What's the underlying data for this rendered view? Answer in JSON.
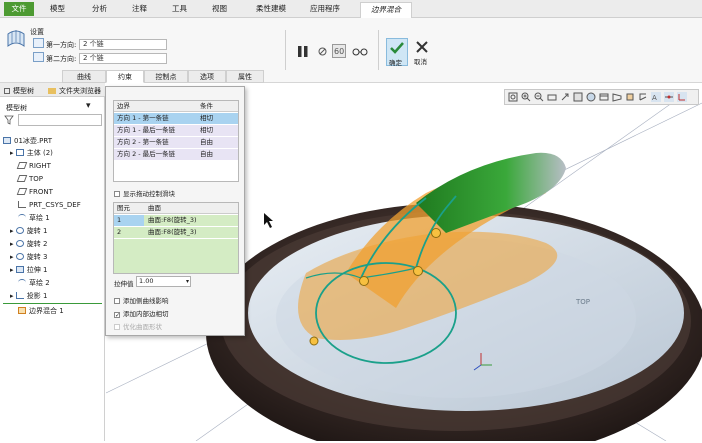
{
  "menubar": {
    "file": "文件",
    "items": [
      "模型",
      "分析",
      "注释",
      "工具",
      "视图",
      "柔性建模",
      "应用程序"
    ],
    "active_tab": "边界混合"
  },
  "ribbon": {
    "settings_label": "设置",
    "first_dir_label": "第一方向:",
    "first_dir_value": "2 个链",
    "second_dir_label": "第二方向:",
    "second_dir_value": "2 个链",
    "ok_label": "确定",
    "cancel_label": "取消",
    "subtabs": [
      "曲线",
      "约束",
      "控制点",
      "选项",
      "属性"
    ]
  },
  "left_panel": {
    "tab_model_tree": "模型树",
    "tab_folder": "文件夹浏览器",
    "tree_header": "模型树",
    "tree_items": [
      {
        "label": "01冰壶.PRT",
        "icon": "part-icon"
      },
      {
        "label": "主体 (2)",
        "icon": "body-icon"
      },
      {
        "label": "RIGHT",
        "icon": "datum-plane-icon"
      },
      {
        "label": "TOP",
        "icon": "datum-plane-icon"
      },
      {
        "label": "FRONT",
        "icon": "datum-plane-icon"
      },
      {
        "label": "PRT_CSYS_DEF",
        "icon": "csys-icon"
      },
      {
        "label": "草绘 1",
        "icon": "sketch-icon"
      },
      {
        "label": "旋转 1",
        "icon": "revolve-icon"
      },
      {
        "label": "旋转 2",
        "icon": "revolve-icon"
      },
      {
        "label": "旋转 3",
        "icon": "revolve-icon"
      },
      {
        "label": "拉伸 1",
        "icon": "extrude-icon"
      },
      {
        "label": "草绘 2",
        "icon": "sketch-icon"
      },
      {
        "label": "投影 1",
        "icon": "projection-icon"
      },
      {
        "label": "边界混合 1",
        "icon": "boundary-blend-icon"
      }
    ]
  },
  "popup": {
    "col_boundary": "边界",
    "col_condition": "条件",
    "rows": [
      {
        "boundary": "方向 1 - 第一条链",
        "condition": "相切",
        "selected": true
      },
      {
        "boundary": "方向 1 - 最后一条链",
        "condition": "相切",
        "selected": false
      },
      {
        "boundary": "方向 2 - 第一条链",
        "condition": "自由",
        "selected": false
      },
      {
        "boundary": "方向 2 - 最后一条链",
        "condition": "自由",
        "selected": false
      }
    ],
    "show_drag_label": "显示拖动控制滑块",
    "col_element": "图元",
    "col_surface": "曲面",
    "surface_rows": [
      {
        "element": "1",
        "surface": "曲面:F8(旋转_3)"
      },
      {
        "element": "2",
        "surface": "曲面:F8(旋转_3)"
      }
    ],
    "stretch_label": "拉伸值",
    "stretch_value": "1.00",
    "opt_add_side": "添加侧曲线影响",
    "opt_add_inner": "添加内部边相切",
    "opt_optimize": "优化曲面形状"
  },
  "viewport": {
    "top_label": "TOP"
  },
  "colors": {
    "accent_green": "#4d9a32",
    "selection_blue": "#a9d3f0",
    "surface_orange": "#f0a030",
    "curve_teal": "#1aa08a"
  }
}
